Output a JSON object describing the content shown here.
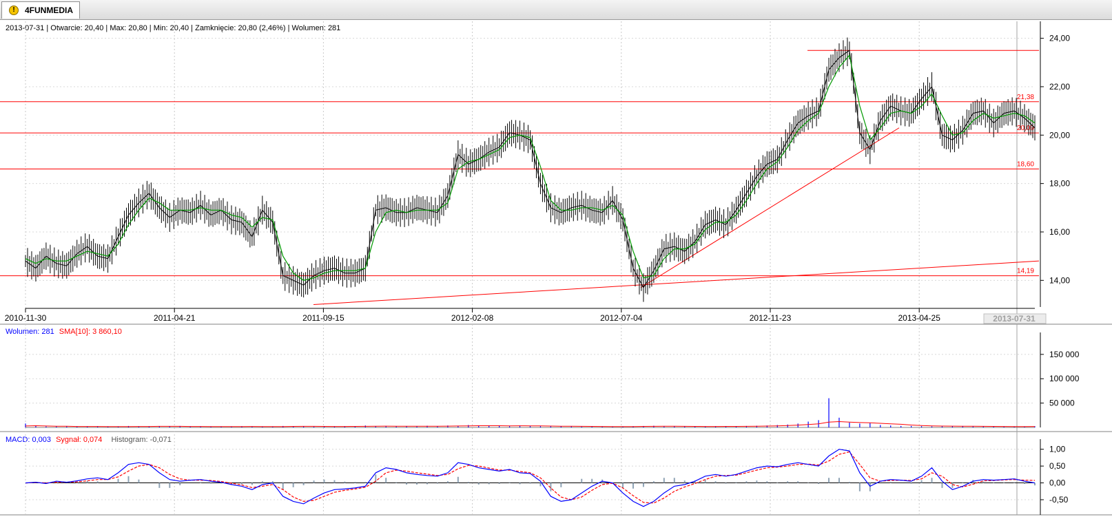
{
  "window": {
    "tab_label": "4FUNMEDIA",
    "tab_icon": "warning-icon"
  },
  "info": {
    "date": "2013-07-31",
    "open_label": "Otwarcie:",
    "open": "20,40",
    "max_label": "Max:",
    "max": "20,80",
    "min_label": "Min:",
    "min": "20,40",
    "close_label": "Zamknięcie:",
    "close": "20,80 (2,46%)",
    "volume_label": "Wolumen:",
    "volume": "281"
  },
  "volume_info": {
    "volume_text": "Wolumen: 281",
    "sma_text": "SMA[10]: 3 860,10"
  },
  "macd_info": {
    "macd_text": "MACD: 0,003",
    "signal_text": "Sygnał: 0,074",
    "hist_text": "Histogram: -0,071"
  },
  "colors": {
    "price": "#000000",
    "sma": "#009900",
    "lines": "#ff0000",
    "volume": "#0000ff",
    "macd": "#0000ff",
    "signal": "#ff0000",
    "histogram": "#8fa3b5"
  },
  "chart_data": [
    {
      "type": "line",
      "title": "",
      "x_tick_labels": [
        "2010-11-30",
        "2011-04-21",
        "2011-09-15",
        "2012-02-08",
        "2012-07-04",
        "2012-11-23",
        "2013-04-25"
      ],
      "cursor_label": "2013-07-31",
      "ylim": [
        12.9,
        24.7
      ],
      "y_ticks": [
        14,
        16,
        18,
        20,
        22,
        24
      ],
      "y_tick_labels": [
        "14,00",
        "16,00",
        "18,00",
        "20,00",
        "22,00",
        "24,00"
      ],
      "horizontal_levels": [
        {
          "value": 21.38,
          "label": "21,38"
        },
        {
          "value": 20.09,
          "label": "20,09"
        },
        {
          "value": 18.6,
          "label": "18,60"
        },
        {
          "value": 14.19,
          "label": "14,19"
        },
        {
          "value": 23.5,
          "label": ""
        }
      ],
      "series": [
        {
          "values": [
            14.8,
            14.5,
            15.0,
            14.7,
            14.6,
            15.1,
            15.4,
            15.0,
            14.9,
            15.8,
            16.7,
            17.2,
            17.6,
            17.0,
            16.6,
            16.9,
            16.8,
            17.1,
            16.7,
            16.9,
            16.5,
            16.4,
            15.8,
            16.9,
            16.4,
            14.2,
            14.0,
            13.8,
            14.2,
            14.4,
            14.5,
            14.3,
            14.3,
            14.5,
            16.9,
            17.0,
            16.8,
            16.8,
            17.0,
            16.9,
            16.8,
            17.5,
            19.2,
            18.8,
            19.0,
            19.3,
            19.5,
            20.1,
            20.0,
            19.8,
            18.0,
            17.0,
            16.8,
            17.0,
            17.1,
            16.9,
            16.8,
            17.3,
            16.5,
            14.5,
            13.7,
            14.4,
            15.3,
            15.4,
            15.2,
            15.6,
            16.3,
            16.5,
            16.3,
            16.9,
            17.6,
            18.3,
            18.8,
            19.0,
            19.8,
            20.5,
            20.8,
            21.0,
            22.7,
            23.2,
            23.5,
            20.1,
            19.4,
            20.6,
            21.2,
            21.0,
            20.9,
            21.5,
            22.0,
            20.0,
            19.8,
            20.2,
            20.9,
            21.0,
            20.5,
            20.9,
            21.0,
            20.7,
            20.3
          ]
        },
        {
          "name": "",
          "values": [
            14.9,
            14.7,
            14.9,
            14.8,
            14.8,
            15.0,
            15.2,
            15.1,
            15.0,
            15.5,
            16.3,
            16.9,
            17.4,
            17.2,
            16.9,
            16.9,
            16.9,
            17.0,
            16.9,
            16.9,
            16.7,
            16.6,
            16.2,
            16.6,
            16.5,
            15.0,
            14.3,
            14.0,
            14.1,
            14.3,
            14.4,
            14.4,
            14.4,
            14.5,
            16.0,
            16.8,
            16.9,
            16.8,
            16.9,
            16.9,
            16.9,
            17.2,
            18.6,
            18.9,
            19.0,
            19.2,
            19.4,
            19.9,
            20.0,
            19.9,
            18.7,
            17.3,
            16.9,
            16.9,
            17.0,
            17.0,
            16.9,
            17.1,
            16.7,
            15.2,
            14.1,
            14.2,
            14.9,
            15.3,
            15.3,
            15.5,
            16.1,
            16.4,
            16.4,
            16.7,
            17.3,
            18.0,
            18.6,
            18.9,
            19.5,
            20.2,
            20.6,
            20.9,
            22.0,
            22.8,
            23.3,
            21.2,
            19.8,
            20.3,
            20.9,
            21.0,
            20.9,
            21.2,
            21.7,
            20.8,
            20.0,
            20.1,
            20.6,
            20.9,
            20.7,
            20.8,
            20.9,
            20.8,
            20.5
          ]
        }
      ]
    },
    {
      "type": "bar",
      "title": "",
      "ylim": [
        0,
        195000
      ],
      "y_ticks": [
        50000,
        100000,
        150000
      ],
      "y_tick_labels": [
        "50 000",
        "100 000",
        "150 000"
      ],
      "series": [
        {
          "name": "Wolumen",
          "values": [
            8000,
            3000,
            2000,
            2000,
            2500,
            1500,
            2000,
            2500,
            1800,
            1500,
            3000,
            2000,
            1500,
            2500,
            2000,
            3000,
            2000,
            1800,
            1500,
            1500,
            2000,
            2500,
            1800,
            1500,
            2000,
            3000,
            2000,
            2500,
            1500,
            2000,
            1800,
            2500,
            2000,
            4000,
            2500,
            3000,
            2000,
            2500,
            2000,
            3500,
            2000,
            4000,
            3000,
            5000,
            4000,
            3500,
            3000,
            2500,
            4000,
            3000,
            2500,
            2000,
            2500,
            2000,
            1500,
            2000,
            1800,
            1500,
            2000,
            2500,
            3000,
            3500,
            2000,
            2500,
            2000,
            1500,
            2000,
            2500,
            2000,
            1800,
            3000,
            3500,
            4000,
            5000,
            6000,
            8000,
            12000,
            15000,
            60000,
            20000,
            10000,
            8000,
            9000,
            5000,
            4000,
            3000,
            3000,
            2500,
            2000,
            2000,
            2500,
            3000,
            2000,
            2000,
            1500,
            2000,
            1500,
            2000,
            2500
          ]
        },
        {
          "name": "SMA[10]",
          "values": [
            3000,
            3500,
            3000,
            2500,
            2500,
            2000,
            2000,
            2000,
            1800,
            1800,
            1800,
            2000,
            2000,
            2200,
            2300,
            2200,
            2000,
            2000,
            1900,
            1800,
            1800,
            1900,
            2000,
            1900,
            1800,
            1900,
            2100,
            2300,
            2200,
            2100,
            2000,
            2000,
            2100,
            2300,
            2500,
            2700,
            2600,
            2500,
            2400,
            2500,
            2500,
            2700,
            2900,
            3300,
            3600,
            3600,
            3500,
            3300,
            3400,
            3300,
            3100,
            2800,
            2600,
            2400,
            2200,
            2100,
            2000,
            1900,
            1800,
            1900,
            2100,
            2300,
            2500,
            2400,
            2300,
            2100,
            2000,
            2000,
            2100,
            2100,
            2200,
            2400,
            2800,
            3300,
            3900,
            4800,
            6000,
            7500,
            11000,
            12000,
            11000,
            10000,
            9500,
            8500,
            7500,
            6500,
            5000,
            4000,
            3200,
            2800,
            2700,
            2600,
            2500,
            2300,
            2100,
            2000,
            1900,
            1900,
            1950
          ]
        }
      ]
    },
    {
      "type": "line",
      "title": "",
      "ylim": [
        -0.95,
        1.3
      ],
      "y_ticks": [
        1.0,
        0.5,
        0.0,
        -0.5
      ],
      "y_tick_labels": [
        "1,00",
        "0,50",
        "0,00",
        "-0,50"
      ],
      "series": [
        {
          "name": "MACD",
          "values": [
            0.0,
            0.02,
            -0.02,
            0.05,
            0.02,
            0.06,
            0.12,
            0.15,
            0.1,
            0.3,
            0.55,
            0.6,
            0.55,
            0.3,
            0.1,
            0.05,
            0.08,
            0.1,
            0.05,
            0.02,
            -0.05,
            -0.1,
            -0.2,
            -0.05,
            0.0,
            -0.4,
            -0.55,
            -0.62,
            -0.45,
            -0.3,
            -0.2,
            -0.18,
            -0.15,
            -0.1,
            0.3,
            0.45,
            0.4,
            0.3,
            0.25,
            0.22,
            0.2,
            0.3,
            0.6,
            0.55,
            0.45,
            0.4,
            0.35,
            0.4,
            0.3,
            0.28,
            0.05,
            -0.4,
            -0.55,
            -0.5,
            -0.3,
            -0.1,
            0.05,
            0.0,
            -0.3,
            -0.55,
            -0.7,
            -0.55,
            -0.3,
            -0.1,
            -0.05,
            0.05,
            0.2,
            0.25,
            0.2,
            0.25,
            0.35,
            0.45,
            0.5,
            0.48,
            0.55,
            0.6,
            0.55,
            0.5,
            0.8,
            1.0,
            0.95,
            0.3,
            -0.1,
            0.05,
            0.1,
            0.08,
            0.05,
            0.2,
            0.45,
            0.05,
            -0.2,
            -0.1,
            0.05,
            0.1,
            0.08,
            0.1,
            0.12,
            0.05,
            0.0
          ]
        },
        {
          "name": "Sygnał",
          "values": [
            0.0,
            0.01,
            0.0,
            0.02,
            0.02,
            0.03,
            0.06,
            0.1,
            0.1,
            0.18,
            0.35,
            0.5,
            0.55,
            0.45,
            0.25,
            0.12,
            0.08,
            0.08,
            0.07,
            0.04,
            -0.01,
            -0.06,
            -0.14,
            -0.1,
            -0.05,
            -0.2,
            -0.42,
            -0.55,
            -0.52,
            -0.4,
            -0.28,
            -0.22,
            -0.18,
            -0.13,
            0.05,
            0.3,
            0.38,
            0.35,
            0.3,
            0.26,
            0.22,
            0.25,
            0.42,
            0.52,
            0.5,
            0.44,
            0.38,
            0.38,
            0.34,
            0.3,
            0.15,
            -0.15,
            -0.42,
            -0.5,
            -0.42,
            -0.22,
            -0.05,
            -0.01,
            -0.15,
            -0.38,
            -0.58,
            -0.6,
            -0.45,
            -0.25,
            -0.12,
            -0.02,
            0.1,
            0.2,
            0.22,
            0.23,
            0.3,
            0.38,
            0.45,
            0.47,
            0.5,
            0.55,
            0.56,
            0.53,
            0.65,
            0.85,
            0.92,
            0.55,
            0.15,
            0.05,
            0.07,
            0.08,
            0.07,
            0.12,
            0.3,
            0.2,
            -0.05,
            -0.12,
            -0.04,
            0.06,
            0.07,
            0.09,
            0.1,
            0.08,
            0.074
          ]
        }
      ]
    }
  ]
}
